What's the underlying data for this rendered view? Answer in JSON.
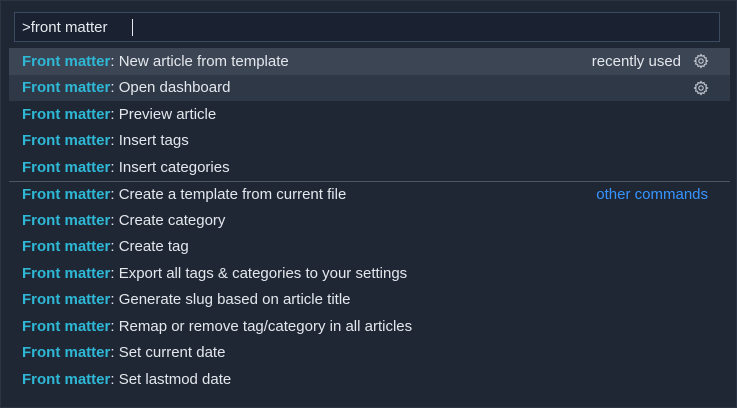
{
  "search": {
    "value": ">front matter"
  },
  "prefix": "Front matter",
  "separator": ":",
  "groups": {
    "recently_used_label": "recently used",
    "other_commands_label": "other commands"
  },
  "commands": [
    {
      "label": "New article from template"
    },
    {
      "label": "Open dashboard"
    },
    {
      "label": "Preview article"
    },
    {
      "label": "Insert tags"
    },
    {
      "label": "Insert categories"
    },
    {
      "label": "Create a template from current file"
    },
    {
      "label": "Create category"
    },
    {
      "label": "Create tag"
    },
    {
      "label": "Export all tags & categories to your settings"
    },
    {
      "label": "Generate slug based on article title"
    },
    {
      "label": "Remap or remove tag/category in all articles"
    },
    {
      "label": "Set current date"
    },
    {
      "label": "Set lastmod date"
    }
  ],
  "colors": {
    "accent_prefix": "#2fb8d6",
    "link": "#3794ff",
    "selected_bg": "#3b4554",
    "panel_bg": "#1f2735"
  },
  "icons": {
    "gear": "gear-icon"
  }
}
